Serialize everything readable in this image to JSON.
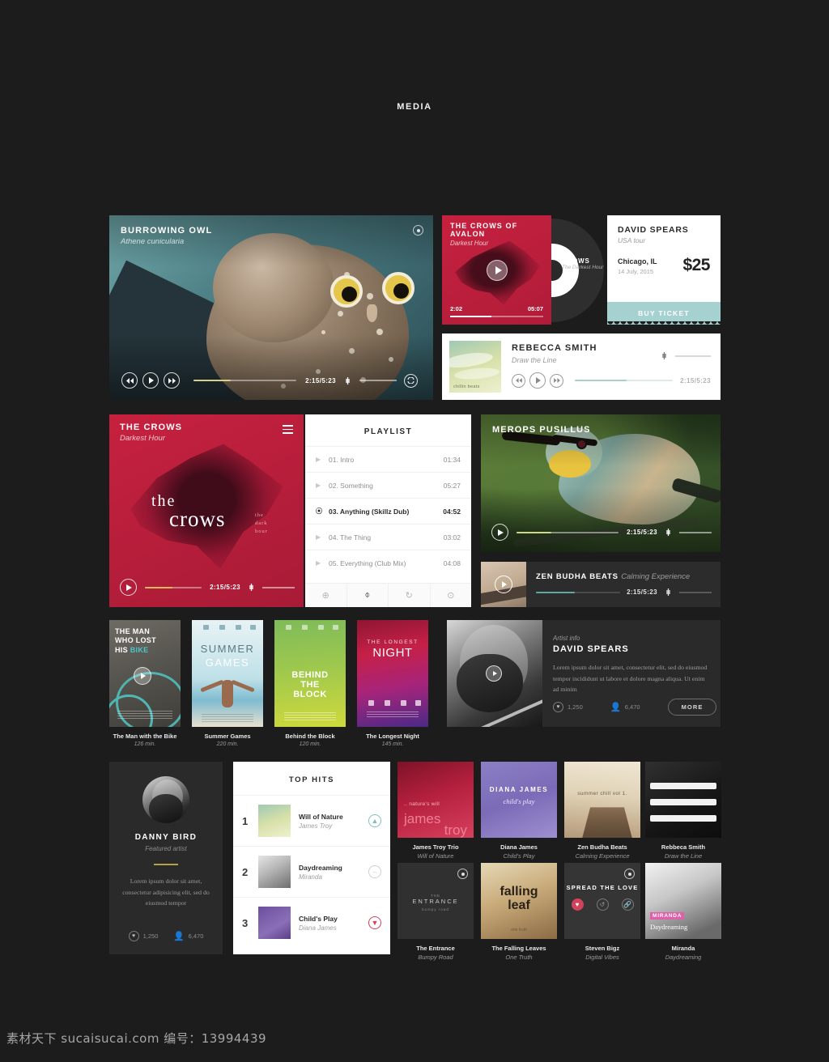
{
  "header": {
    "title": "MEDIA"
  },
  "owl_video": {
    "title": "BURROWING OWL",
    "subtitle": "Athene cunicularia",
    "time": "2:15/5:23",
    "icons": {
      "record": "record-icon",
      "rewind": "rewind-icon",
      "play": "play-icon",
      "forward": "forward-icon",
      "volume": "volume-icon",
      "fullscreen": "fullscreen-icon"
    }
  },
  "avalon": {
    "title": "THE CROWS OF AVALON",
    "subtitle": "Darkest Hour",
    "elapsed": "2:02",
    "duration": "05:07",
    "disc_title": "CROWS",
    "disc_sub": "The Darkest Hour"
  },
  "ticket": {
    "artist": "DAVID SPEARS",
    "tour": "USA tour",
    "city": "Chicago, IL",
    "date": "14 July, 2015",
    "price": "$25",
    "button": "BUY TICKET",
    "accent": "#a5d2d0"
  },
  "rebecca": {
    "title": "REBECCA SMITH",
    "subtitle": "Draw the Line",
    "time": "2:15/5:23",
    "art_label": "chillin beats"
  },
  "crows_album": {
    "title": "THE CROWS",
    "subtitle": "Darkest Hour",
    "art_a": "the",
    "art_b": "crows",
    "art_c": "the dark hour",
    "time": "2:15/5:23",
    "accent": "#c6213f"
  },
  "playlist": {
    "title": "PLAYLIST",
    "tracks": [
      {
        "name": "01. Intro",
        "time": "01:34",
        "active": false
      },
      {
        "name": "02. Something",
        "time": "05:27",
        "active": false
      },
      {
        "name": "03. Anything (Skillz Dub)",
        "time": "04:52",
        "active": true
      },
      {
        "name": "04. The Thing",
        "time": "03:02",
        "active": false
      },
      {
        "name": "05. Everything (Club Mix)",
        "time": "04:08",
        "active": false
      }
    ],
    "tools": [
      {
        "icon": "plus-circle-icon",
        "glyph": "⊕",
        "active": false
      },
      {
        "icon": "trash-icon",
        "glyph": "⌽",
        "active": true
      },
      {
        "icon": "repeat-icon",
        "glyph": "↻",
        "active": false
      },
      {
        "icon": "download-circle-icon",
        "glyph": "⊙",
        "active": false
      }
    ]
  },
  "merops": {
    "title": "MEROPS PUSILLUS",
    "time": "2:15/5:23"
  },
  "zen": {
    "title": "ZEN BUDHA BEATS",
    "subtitle": "Calming Experience",
    "time": "2:15/5:23"
  },
  "movies": [
    {
      "poster_title": "THE MAN WHO LOST HIS BIKE",
      "highlight": "BIKE",
      "name": "The Man with the Bike",
      "duration": "126 min."
    },
    {
      "poster_title_1": "SUMMER",
      "poster_title_2": "GAMES",
      "name": "Summer Games",
      "duration": "220 min."
    },
    {
      "poster_title": "BEHIND THE BLOCK",
      "name": "Behind the Block",
      "duration": "120 min."
    },
    {
      "poster_title_1": "THE LONGEST",
      "poster_title_2": "NIGHT",
      "name": "The Longest Night",
      "duration": "145 min."
    }
  ],
  "artist_info": {
    "kicker": "Artist info",
    "name": "DAVID SPEARS",
    "description": "Lorem ipsum dolor sit amet, consectetur elit, sed do eiusmod tempor incididunt ut labore et dolore magna aliqua. Ut enim ad minim",
    "likes": "1,250",
    "followers": "6,470",
    "more_label": "MORE"
  },
  "featured_artist": {
    "name": "DANNY BIRD",
    "role": "Featured artist",
    "description": "Lorem ipsum dolor sit amet, consectetur adipisicing elit, sed do eiusmod tempor",
    "likes": "1,250",
    "followers": "6,470"
  },
  "top_hits": {
    "title": "TOP HITS",
    "items": [
      {
        "rank": "1",
        "title": "Will of Nature",
        "artist": "James Troy",
        "action_glyph": "▲",
        "action_style": "teal"
      },
      {
        "rank": "2",
        "title": "Daydreaming",
        "artist": "Miranda",
        "action_glyph": "–",
        "action_style": "grey"
      },
      {
        "rank": "3",
        "title": "Child's Play",
        "artist": "Diana James",
        "action_glyph": "▼",
        "action_style": "red"
      }
    ]
  },
  "albums": [
    {
      "cover_line1": ".. nature's will",
      "cover_line2": "james",
      "cover_line3": "troy",
      "name": "James Troy Trio",
      "release": "Will of Nature"
    },
    {
      "cover_line1": "DIANA JAMES",
      "cover_line2": "child's play",
      "name": "Diana James",
      "release": "Child's Play"
    },
    {
      "cover_line1": "summer chill vol 1.",
      "name": "Zen Budha Beats",
      "release": "Calming Experience"
    },
    {
      "name": "Rebbeca Smith",
      "release": "Draw the Line"
    },
    {
      "cover_line1": "ENTRANCE",
      "cover_pre": "THE",
      "cover_post": "bumpy road",
      "name": "The Entrance",
      "release": "Bumpy Road"
    },
    {
      "cover_line1": "falling",
      "cover_line2": "leaf",
      "cover_post": "one truth",
      "name": "The Falling Leaves",
      "release": "One Truth"
    },
    {
      "cover_line1": "SPREAD THE LOVE",
      "name": "Steven Bigz",
      "release": "Digital Vibes"
    },
    {
      "cover_line1": "MIRANDA",
      "cover_line2": "Daydreaming",
      "name": "Miranda",
      "release": "Daydreaming"
    }
  ],
  "watermark": "素材天下 sucaisucai.com  编号：13994439"
}
